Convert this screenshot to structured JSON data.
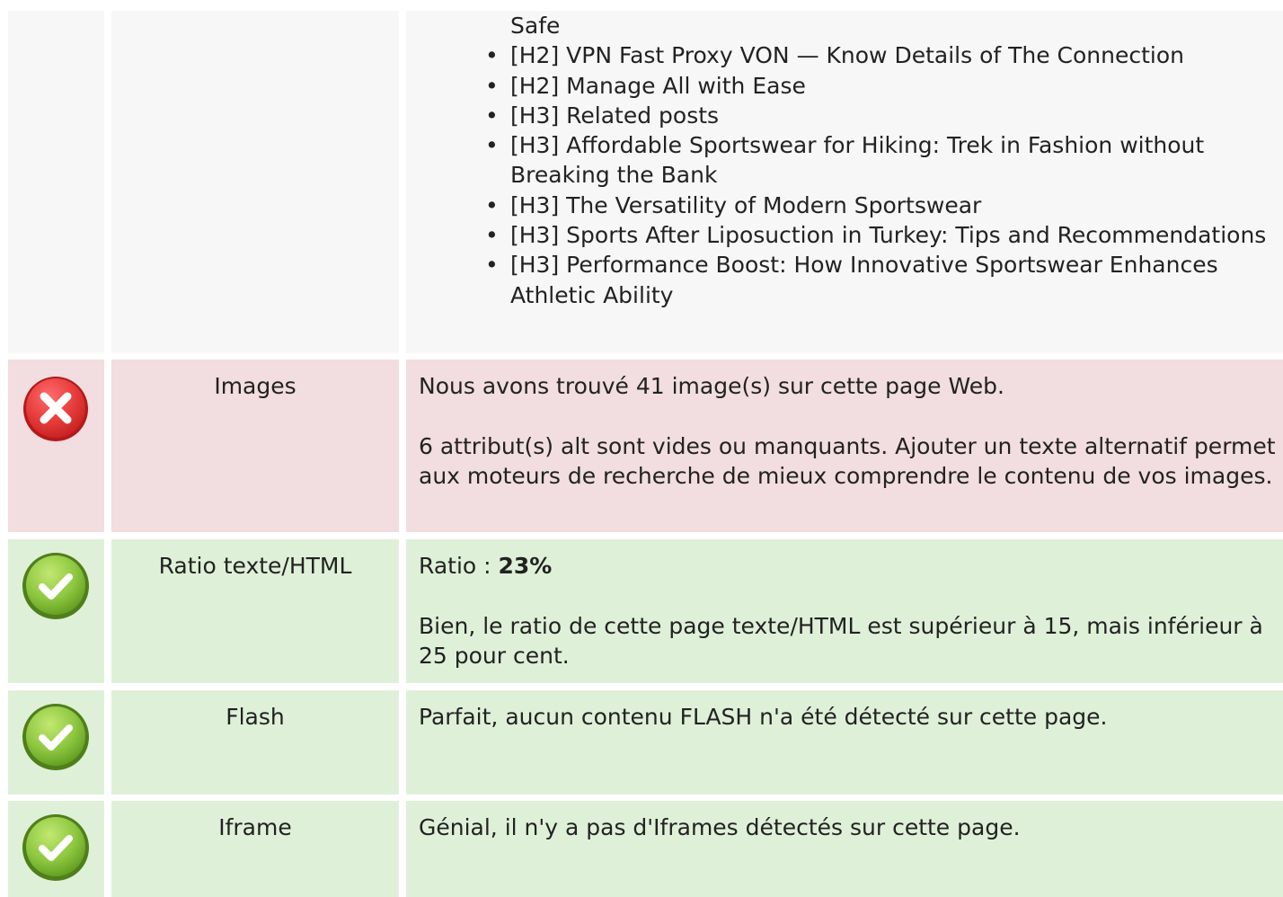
{
  "headings_row": {
    "items": [
      {
        "text": "Safe",
        "continuation": true
      },
      {
        "text": "[H2] VPN Fast Proxy VON — Know Details of The Connection"
      },
      {
        "text": "[H2] Manage All with Ease"
      },
      {
        "text": "[H3] Related posts"
      },
      {
        "text": "[H3] Affordable Sportswear for Hiking: Trek in Fashion without Breaking the Bank"
      },
      {
        "text": "[H3] The Versatility of Modern Sportswear"
      },
      {
        "text": "[H3] Sports After Liposuction in Turkey: Tips and Recommendations"
      },
      {
        "text": "[H3] Performance Boost: How Innovative Sportswear Enhances Athletic Ability"
      }
    ]
  },
  "images_row": {
    "status": "error",
    "label": "Images",
    "line1": "Nous avons trouvé 41 image(s) sur cette page Web.",
    "line2": "6 attribut(s) alt sont vides ou manquants. Ajouter un texte alternatif permet aux moteurs de recherche de mieux comprendre le contenu de vos images."
  },
  "ratio_row": {
    "status": "ok",
    "label": "Ratio texte/HTML",
    "ratio_prefix": "Ratio : ",
    "ratio_value": "23%",
    "line2": "Bien, le ratio de cette page texte/HTML est supérieur à 15, mais inférieur à 25 pour cent."
  },
  "flash_row": {
    "status": "ok",
    "label": "Flash",
    "line1": "Parfait, aucun contenu FLASH n'a été détecté sur cette page."
  },
  "iframe_row": {
    "status": "ok",
    "label": "Iframe",
    "line1": "Génial, il n'y a pas d'Iframes détectés sur cette page."
  },
  "icons": {
    "error": "error-x-icon",
    "ok": "success-check-icon"
  },
  "colors": {
    "error_bg": "#f2dde0",
    "ok_bg": "#dff0d8",
    "neutral_bg": "#f7f7f7",
    "error_icon": "#e53a3a",
    "ok_icon": "#8cc63f"
  }
}
